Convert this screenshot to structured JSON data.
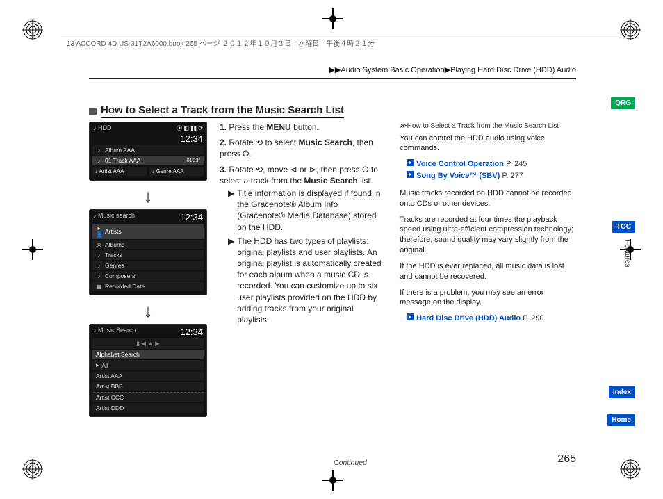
{
  "header": {
    "print_meta": "13 ACCORD 4D US-31T2A6000.book  265 ページ  ２０１２年１０月３日　水曜日　午後４時２１分",
    "breadcrumb_prefix": "▶▶",
    "breadcrumb_1": "Audio System Basic Operation",
    "breadcrumb_sep": "▶",
    "breadcrumb_2": "Playing Hard Disc Drive (HDD) Audio"
  },
  "section": {
    "title": "How to Select a Track from the Music Search List"
  },
  "screens": {
    "s1": {
      "title": "HDD",
      "time": "12:34",
      "album": "Album AAA",
      "track": "01 Track AAA",
      "track_time": "01'23\"",
      "artist": "Artist AAA",
      "genre": "Genre AAA"
    },
    "s2": {
      "title": "Music search",
      "time": "12:34",
      "items": [
        "Artists",
        "Albums",
        "Tracks",
        "Genres",
        "Composers",
        "Recorded Date"
      ]
    },
    "s3": {
      "title": "Music Search",
      "time": "12:34",
      "items": [
        "Alphabet Search",
        "All",
        "Artist AAA",
        "Artist BBB",
        "Artist CCC",
        "Artist DDD"
      ]
    }
  },
  "steps": {
    "s1_a": "Press the ",
    "s1_b": "MENU",
    "s1_c": " button.",
    "s2_a": "Rotate ",
    "s2_b": " to select ",
    "s2_c": "Music Search",
    "s2_d": ", then press ",
    "s2_e": ".",
    "s3_a": "Rotate ",
    "s3_b": ", move ",
    "s3_c": " or ",
    "s3_d": ", then press ",
    "s3_e": " to select a track from the ",
    "s3_f": "Music Search",
    "s3_g": " list.",
    "b1": "Title information is displayed if found in the Gracenote® Album Info (Gracenote® Media Database) stored on the HDD.",
    "b2": "The HDD has two types of playlists: original playlists and user playlists. An original playlist is automatically created for each album when a music CD is recorded. You can customize up to six user playlists provided on the HDD by adding tracks from your original playlists."
  },
  "side": {
    "head": "How to Select a Track from the Music Search List",
    "p1": "You can control the HDD audio using voice commands.",
    "link1_label": "Voice Control Operation",
    "link1_page": "P. 245",
    "link2_label": "Song By Voice™ (SBV)",
    "link2_page": "P. 277",
    "p2": "Music tracks recorded on HDD cannot be recorded onto CDs or other devices.",
    "p3": "Tracks are recorded at four times the playback speed using ultra-efficient compression technology; therefore, sound quality may vary slightly from the original.",
    "p4": "If the HDD is ever replaced, all music data is lost and cannot be recovered.",
    "p5": "If there is a problem, you may see an error message on the display.",
    "link3_label": "Hard Disc Drive (HDD) Audio",
    "link3_page": "P. 290"
  },
  "footer": {
    "continued": "Continued",
    "pagenum": "265"
  },
  "tabs": {
    "qrg": "QRG",
    "toc": "TOC",
    "features": "Features",
    "index": "Index",
    "home": "Home"
  },
  "arrows": {
    "down": "↓"
  },
  "chart_data": null
}
